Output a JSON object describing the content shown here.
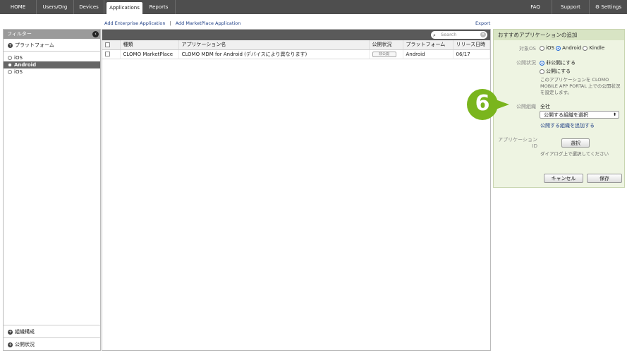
{
  "nav": {
    "home": "HOME",
    "users_org": "Users/Org",
    "devices": "Devices",
    "applications": "Applications",
    "reports": "Reports",
    "faq": "FAQ",
    "support": "Support",
    "settings": "Settings"
  },
  "links": {
    "add_enterprise": "Add Enterprise Application",
    "separator": "|",
    "add_marketplace": "Add MarketPlace Application",
    "export": "Export"
  },
  "sidebar": {
    "title": "フィルター",
    "platform_section": "プラットフォーム",
    "platforms": [
      "iOS",
      "Android",
      "iOS"
    ],
    "org_section": "組織構成",
    "publish_section": "公開状況"
  },
  "search": {
    "placeholder": "Search"
  },
  "table": {
    "columns": [
      "種類",
      "アプリケーション名",
      "公開状況",
      "プラットフォーム",
      "リリース日時"
    ],
    "rows": [
      {
        "type": "CLOMO MarketPlace",
        "name": "CLOMO MDM for Android (デバイスにより異なります)",
        "status": "非公開",
        "platform": "Android",
        "release": "06/17"
      }
    ]
  },
  "panel": {
    "title": "おすすめアプリケーションの追加",
    "os_label": "対象OS",
    "os_options": [
      "iOS",
      "Android",
      "Kindle"
    ],
    "status_label": "公開状況",
    "status_options": [
      "非公開にする",
      "公開にする"
    ],
    "status_note": "このアプリケーションを CLOMO MOBILE APP PORTAL 上での公開状況を設定します。",
    "org_label": "公開組織",
    "org_value": "全社",
    "org_select": "公開する組織を選択",
    "org_add_link": "公開する組織を追加する",
    "appid_label": "アプリケーションID",
    "select_button": "選択",
    "select_note": "ダイアログ上で選択してください",
    "cancel_button": "キャンセル",
    "save_button": "保存"
  },
  "callout": {
    "number": "6"
  },
  "colors": {
    "accent_green": "#7ab51d",
    "nav_bg": "#4e4e4e",
    "link_blue": "#1f3f86"
  }
}
